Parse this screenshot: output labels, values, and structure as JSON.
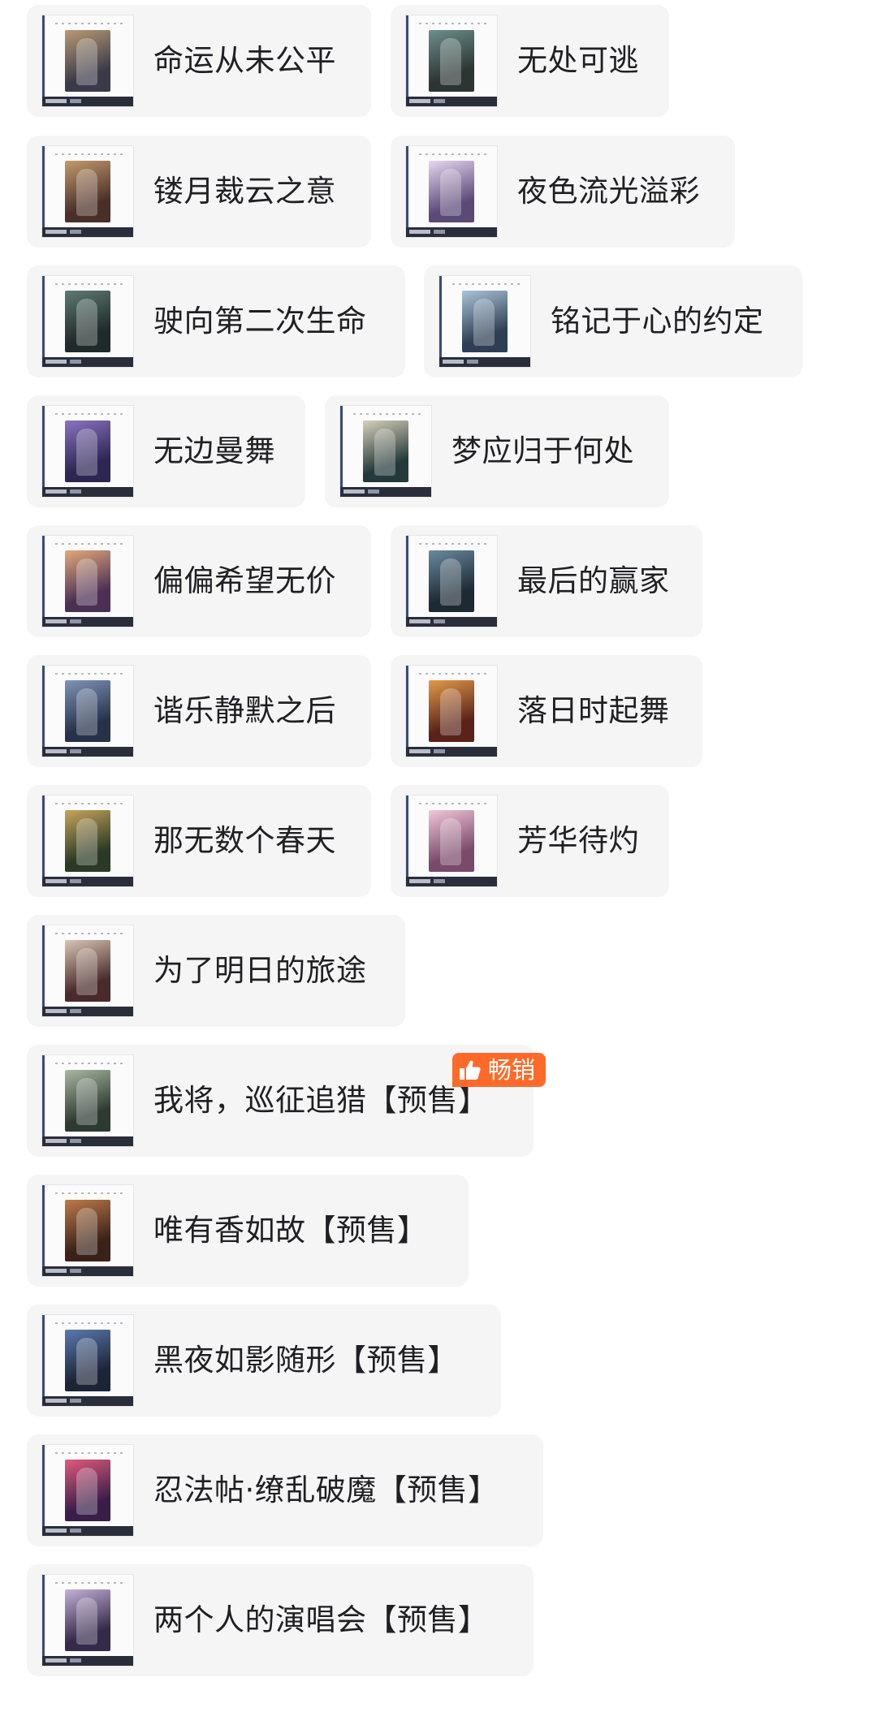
{
  "items": [
    {
      "label": "命运从未公平",
      "art": [
        "#3b3a4a",
        "#b99a74"
      ]
    },
    {
      "label": "无处可逃",
      "art": [
        "#2c3533",
        "#6d8f8c"
      ]
    },
    {
      "label": "镂月裁云之意",
      "art": [
        "#4a2f28",
        "#c49a6c"
      ]
    },
    {
      "label": "夜色流光溢彩",
      "art": [
        "#5b4a78",
        "#e6d7f0"
      ]
    },
    {
      "label": "驶向第二次生命",
      "art": [
        "#1f2a2a",
        "#5e7a72"
      ]
    },
    {
      "label": "铭记于心的约定",
      "art": [
        "#2e3f55",
        "#a9c4d8"
      ]
    },
    {
      "label": "无边曼舞",
      "art": [
        "#2d2552",
        "#8a73c2"
      ]
    },
    {
      "label": "梦应归于何处",
      "art": [
        "#243a3a",
        "#d7d0b8"
      ]
    },
    {
      "label": "偏偏希望无价",
      "art": [
        "#4b2f55",
        "#e3a978"
      ]
    },
    {
      "label": "最后的赢家",
      "art": [
        "#1c2a33",
        "#6a8aa0"
      ]
    },
    {
      "label": "谐乐静默之后",
      "art": [
        "#26324a",
        "#7f94b8"
      ]
    },
    {
      "label": "落日时起舞",
      "art": [
        "#5a2218",
        "#e39a4a"
      ]
    },
    {
      "label": "那无数个春天",
      "art": [
        "#2a3a24",
        "#c6a45a"
      ]
    },
    {
      "label": "芳华待灼",
      "art": [
        "#7a4a6a",
        "#f2c6d8"
      ]
    },
    {
      "label": "为了明日的旅途",
      "art": [
        "#4a2a2a",
        "#d8c6b4"
      ]
    },
    {
      "label": "我将，巡征追猎【预售】",
      "art": [
        "#2d3a32",
        "#a8b8a0"
      ]
    },
    {
      "label": "唯有香如故【预售】",
      "art": [
        "#3a2218",
        "#c07a4a"
      ]
    },
    {
      "label": "黑夜如影随形【预售】",
      "art": [
        "#1c2438",
        "#5a7ab0"
      ]
    },
    {
      "label": "忍法帖·缭乱破魔【预售】",
      "art": [
        "#3a1e4a",
        "#e05a7a"
      ]
    },
    {
      "label": "两个人的演唱会【预售】",
      "art": [
        "#352a4a",
        "#c4b0d8"
      ]
    }
  ],
  "badge": {
    "label": "畅销",
    "icon": "thumbs-up-icon",
    "color": "#ff6a2a"
  }
}
